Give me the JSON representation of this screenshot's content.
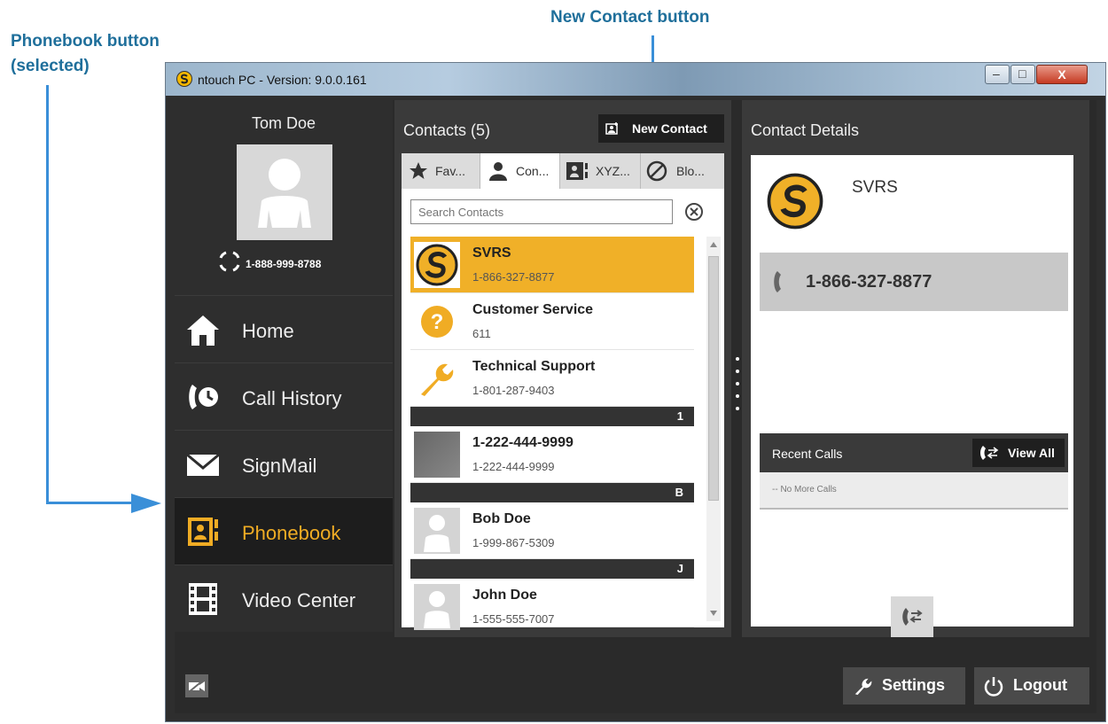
{
  "annotations": {
    "phonebook_label_line1": "Phonebook button",
    "phonebook_label_line2": "(selected)",
    "new_contact_label": "New Contact button"
  },
  "window": {
    "title": "ntouch PC - Version: 9.0.0.161",
    "minimize_label": "–",
    "maximize_label": "□",
    "close_label": "X"
  },
  "user": {
    "name": "Tom Doe",
    "phone": "1-888-999-8788"
  },
  "nav": {
    "items": [
      {
        "label": "Home",
        "icon": "home-icon"
      },
      {
        "label": "Call History",
        "icon": "call-history-icon"
      },
      {
        "label": "SignMail",
        "icon": "envelope-icon"
      },
      {
        "label": "Phonebook",
        "icon": "phonebook-icon",
        "selected": true
      },
      {
        "label": "Video Center",
        "icon": "film-icon"
      }
    ]
  },
  "contacts": {
    "title": "Contacts (5)",
    "new_contact_label": "New Contact",
    "tabs": [
      "Fav...",
      "Con...",
      "XYZ...",
      "Blo..."
    ],
    "search_placeholder": "Search Contacts",
    "rows": [
      {
        "name": "SVRS",
        "phone": "1-866-327-8877",
        "selected": true
      },
      {
        "name": "Customer Service",
        "phone": "611"
      },
      {
        "name": "Technical Support",
        "phone": "1-801-287-9403"
      },
      {
        "name": "1-222-444-9999",
        "phone": "1-222-444-9999"
      },
      {
        "name": "Bob Doe",
        "phone": "1-999-867-5309"
      },
      {
        "name": "John Doe",
        "phone": "1-555-555-7007"
      }
    ],
    "sections": [
      "1",
      "B",
      "J"
    ]
  },
  "details": {
    "title": "Contact Details",
    "name": "SVRS",
    "phone": "1-866-327-8877",
    "recent_calls_label": "Recent Calls",
    "view_all_label": "View All",
    "no_more_calls": "-- No More Calls"
  },
  "footer": {
    "settings_label": "Settings",
    "logout_label": "Logout"
  },
  "colors": {
    "accent": "#f0ac24",
    "annotation": "#1f6f9b",
    "arrow": "#3a8fd8"
  }
}
